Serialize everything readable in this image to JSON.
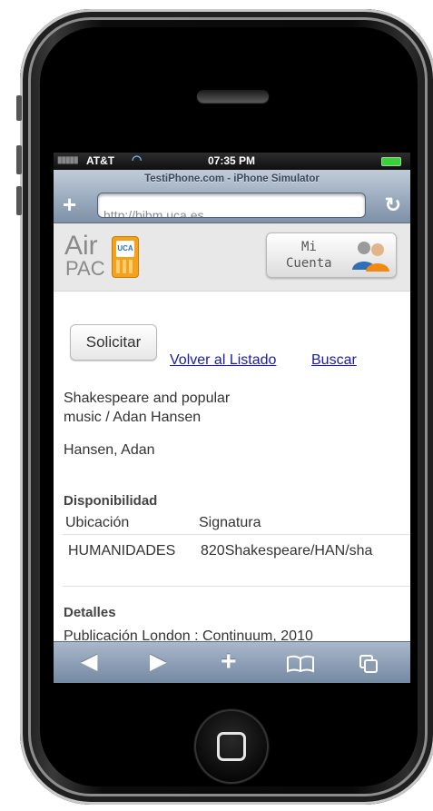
{
  "status_bar": {
    "carrier": "AT&T",
    "time": "07:35 PM"
  },
  "browser": {
    "title": "TestiPhone.com - iPhone Simulator",
    "url": "http://bibm.uca.es"
  },
  "header": {
    "logo_line1": "Air",
    "logo_line2": "PAC",
    "logo_badge": "UCA",
    "account_line1": "Mi",
    "account_line2": "Cuenta"
  },
  "actions": {
    "request_label": "Solicitar",
    "back_label": "Volver al Listado",
    "search_label": "Buscar"
  },
  "record": {
    "title_line1": "Shakespeare and popular",
    "title_line2": "music / Adan Hansen",
    "author": "Hansen, Adan"
  },
  "availability": {
    "heading": "Disponibilidad",
    "col_location": "Ubicación",
    "col_callnumber": "Signatura",
    "location": "HUMANIDADES",
    "callnumber": "820Shakespeare/HAN/sha"
  },
  "details": {
    "heading": "Detalles",
    "publication": "Publicación London : Continuum, 2010"
  },
  "colors": {
    "link": "#1a1aa6",
    "toolbar": "#8a9bb2",
    "logo_orange": "#f4a21c"
  }
}
